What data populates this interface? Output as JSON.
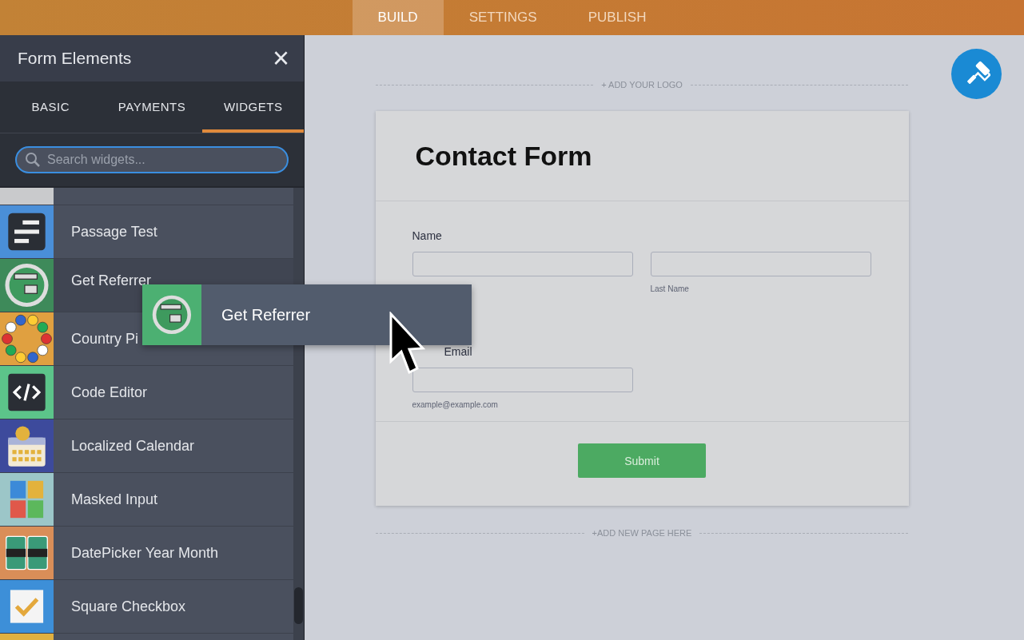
{
  "top_tabs": [
    {
      "label": "BUILD",
      "selected": true
    },
    {
      "label": "SETTINGS",
      "selected": false
    },
    {
      "label": "PUBLISH",
      "selected": false
    }
  ],
  "panel": {
    "title": "Form Elements",
    "close": "×",
    "tabs": [
      {
        "label": "BASIC",
        "selected": false
      },
      {
        "label": "PAYMENTS",
        "selected": false
      },
      {
        "label": "WIDGETS",
        "selected": true
      }
    ],
    "search": {
      "placeholder": "Search widgets..."
    },
    "items": [
      {
        "kind": "blank",
        "color": "#c9cacc",
        "hovered": false
      },
      {
        "kind": "passage",
        "label": "Passage Test",
        "color": "#4a8fd8",
        "hovered": false
      },
      {
        "kind": "globe",
        "label": "Get Referrer",
        "color": "#3e8a5a",
        "hovered": true
      },
      {
        "kind": "flags",
        "label": "Country Pi",
        "color": "#e0a040",
        "hovered": false
      },
      {
        "kind": "code",
        "label": "Code Editor",
        "color": "#5cc48a",
        "hovered": false
      },
      {
        "kind": "calendar",
        "label": "Localized Calendar",
        "color": "#3d4a9c",
        "hovered": false
      },
      {
        "kind": "numbers",
        "label": "Masked Input",
        "color": "#9cc6c8",
        "hovered": false
      },
      {
        "kind": "datepicker",
        "label": "DatePicker Year Month",
        "color": "#d98e58",
        "hovered": false
      },
      {
        "kind": "checkbox",
        "label": "Square Checkbox",
        "color": "#3d8fd8",
        "hovered": false
      },
      {
        "kind": "blank",
        "color": "#e0b040",
        "hovered": false
      }
    ]
  },
  "drag_ghost": {
    "label": "Get Referrer",
    "color": "#4cb072"
  },
  "canvas": {
    "add_logo": "+ ADD YOUR LOGO",
    "add_page": "+ADD NEW PAGE HERE",
    "form": {
      "title": "Contact Form",
      "name_label": "Name",
      "last_name_sublabel": "Last Name",
      "email_label": "Email",
      "email_sublabel": "example@example.com",
      "submit": "Submit"
    }
  }
}
